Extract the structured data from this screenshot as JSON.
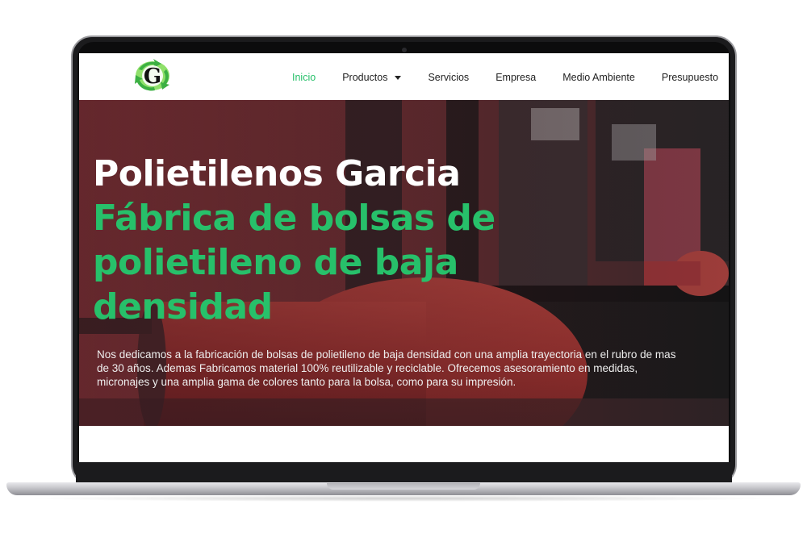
{
  "nav": {
    "logo_letter": "G",
    "items": [
      {
        "label": "Inicio",
        "active": true,
        "has_dropdown": false
      },
      {
        "label": "Productos",
        "active": false,
        "has_dropdown": true
      },
      {
        "label": "Servicios",
        "active": false,
        "has_dropdown": false
      },
      {
        "label": "Empresa",
        "active": false,
        "has_dropdown": false
      },
      {
        "label": "Medio Ambiente",
        "active": false,
        "has_dropdown": false
      },
      {
        "label": "Presupuesto",
        "active": false,
        "has_dropdown": false
      }
    ]
  },
  "hero": {
    "title_plain": "Polietilenos Garcia",
    "title_accent": "Fábrica de bolsas de polietileno de baja densidad",
    "description": "Nos dedicamos a la fabricación de bolsas de polietileno de baja densidad con una amplia trayectoria en el rubro de mas de 30 años. Ademas Fabricamos material 100% reutilizable y reciclable. Ofrecemos asesoramiento en medidas, micronajes y una amplia gama de colores tanto para la bolsa, como para su impresión."
  },
  "colors": {
    "accent": "#27c06a",
    "nav_text": "#222222",
    "hero_text": "#ffffff",
    "laptop_frame": "#1b1b1d"
  },
  "icons": {
    "logo": "recycle-arrows-logo-icon",
    "dropdown": "caret-down-icon"
  }
}
